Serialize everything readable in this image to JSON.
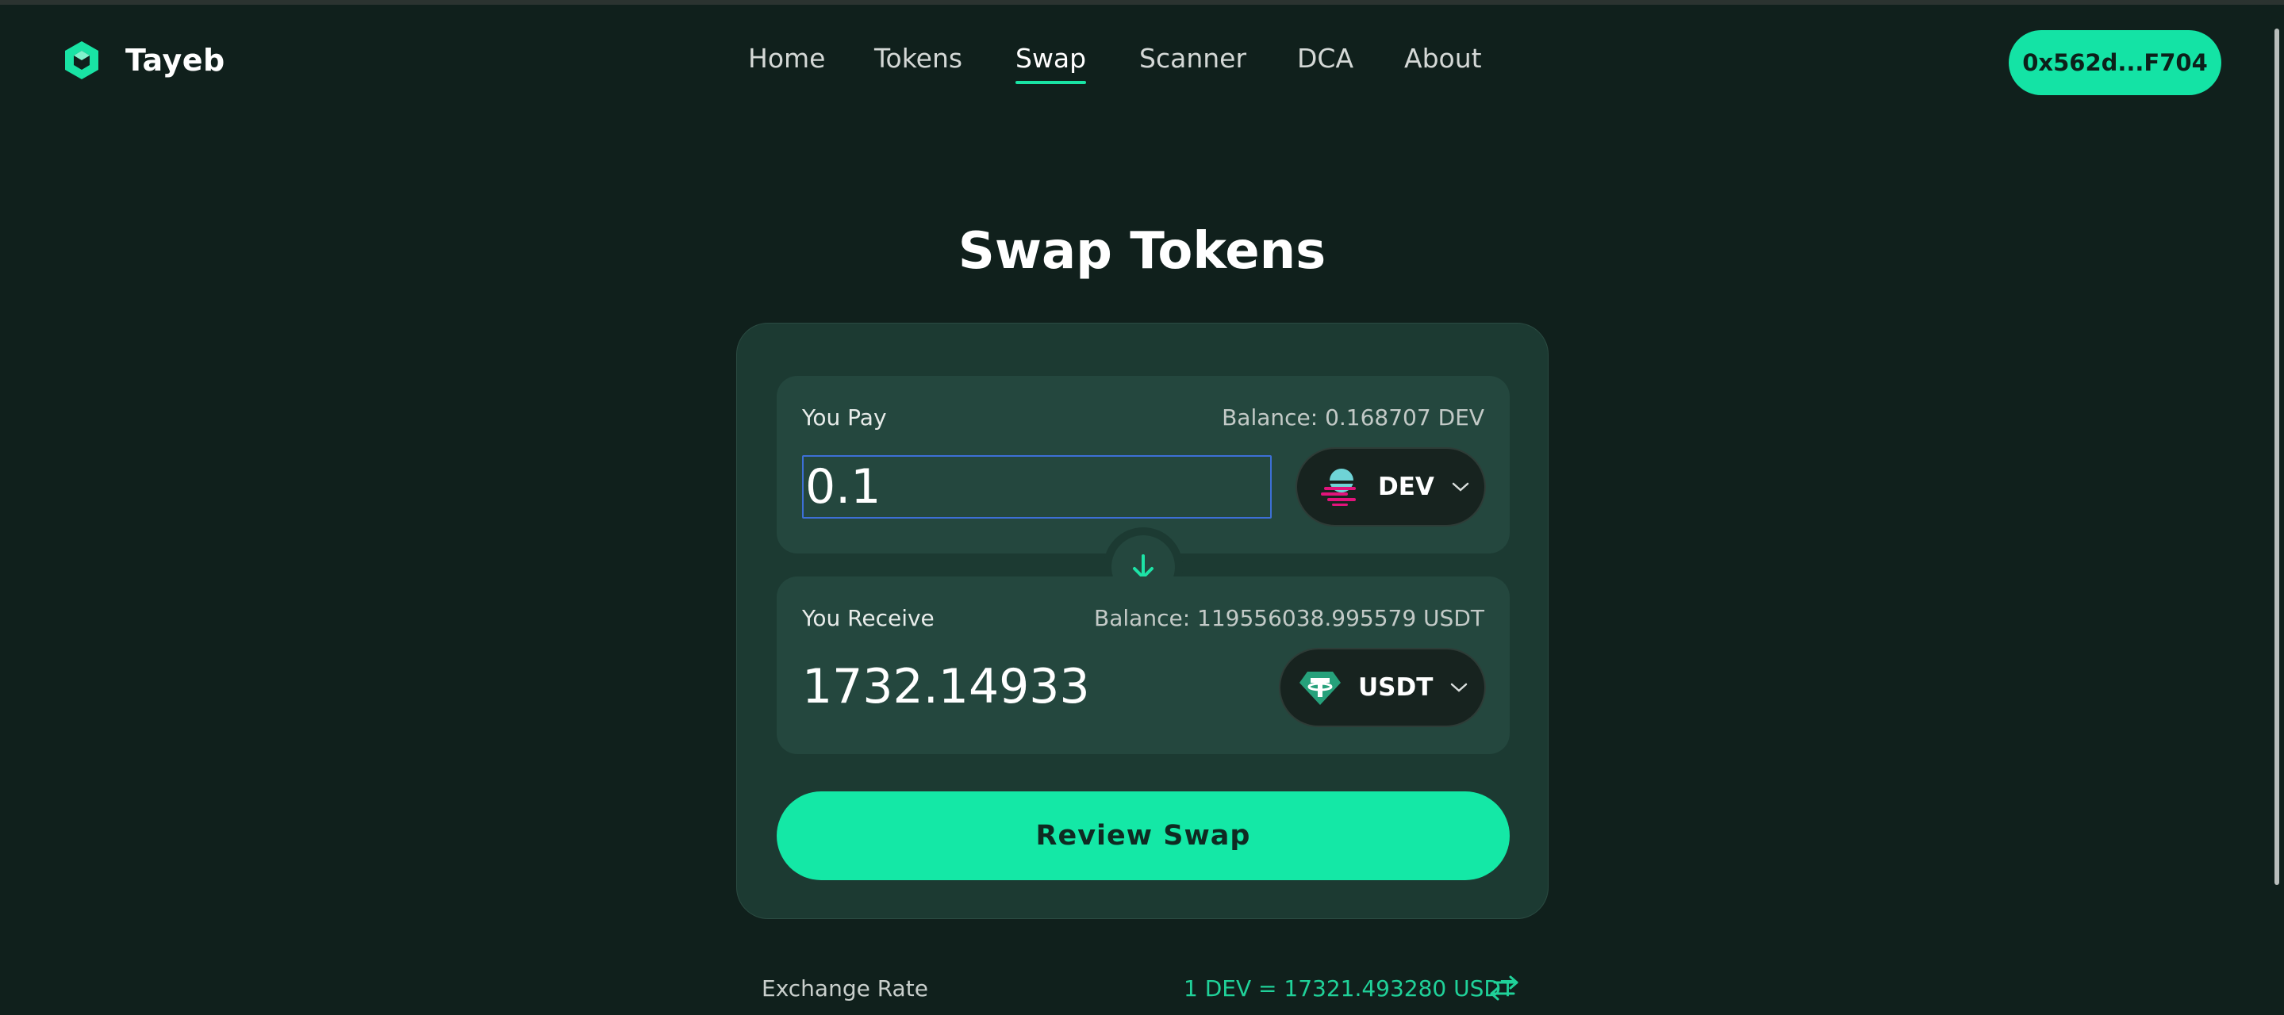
{
  "app": {
    "name": "Tayeb"
  },
  "nav": {
    "items": [
      {
        "label": "Home"
      },
      {
        "label": "Tokens"
      },
      {
        "label": "Swap"
      },
      {
        "label": "Scanner"
      },
      {
        "label": "DCA"
      },
      {
        "label": "About"
      }
    ],
    "active": "Swap"
  },
  "wallet": {
    "address": "0x562d...F704"
  },
  "page": {
    "title": "Swap Tokens"
  },
  "pay": {
    "label": "You Pay",
    "balance": "Balance: 0.168707 DEV",
    "amount": "0.1",
    "token": {
      "symbol": "DEV",
      "icon": "dev-token-icon"
    }
  },
  "receive": {
    "label": "You Receive",
    "balance": "Balance: 119556038.995579 USDT",
    "amount": "1732.14933",
    "token": {
      "symbol": "USDT",
      "icon": "tether-token-icon"
    }
  },
  "review_button": "Review Swap",
  "exchange_rate": {
    "label": "Exchange Rate",
    "value": "1 DEV = 17321.493280 USDT"
  },
  "colors": {
    "background": "#10201c",
    "accent": "#14e3a5",
    "card": "#1c3a32",
    "panel": "#24473e"
  }
}
